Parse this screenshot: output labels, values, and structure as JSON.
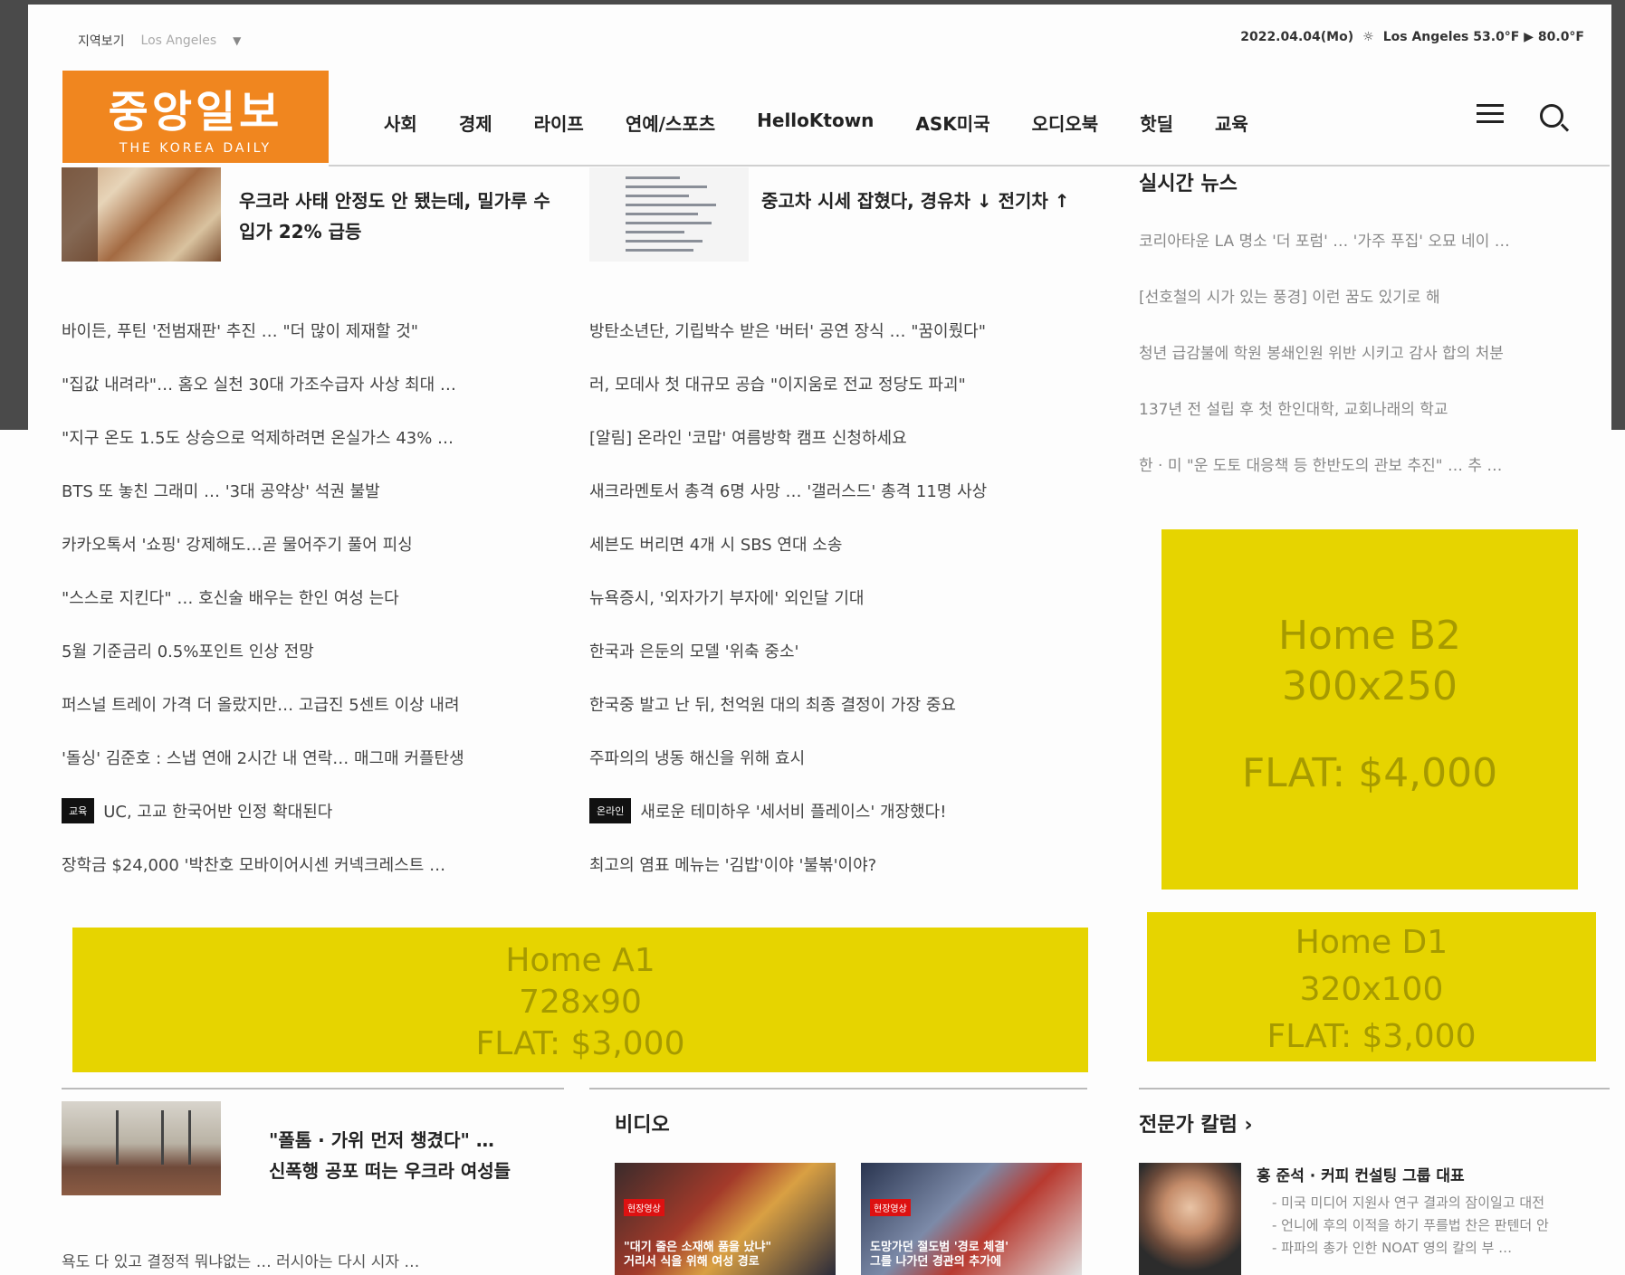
{
  "topbar": {
    "region_label": "지역보기",
    "region_value": "Los Angeles",
    "date": "2022.04.04(Mo)",
    "weather": "Los Angeles 53.0°F ▶ 80.0°F"
  },
  "logo": {
    "ko": "중앙일보",
    "en": "THE KOREA DAILY"
  },
  "nav": {
    "items": [
      "사회",
      "경제",
      "라이프",
      "연예/스포츠",
      "HelloKtown",
      "ASK미국",
      "오디오북",
      "핫딜",
      "교육"
    ]
  },
  "top_headlines": {
    "left": "우크라 사태 안정도 안 됐는데, 밀가루 수입가 22% 급등",
    "middle": "중고차 시세 잡혔다, 경유차 ↓ 전기차 ↑"
  },
  "left_list": [
    "바이든, 푸틴 '전범재판' 추진 … \"더 많이 제재할 것\"",
    "\"집값 내려라\"… 홈오 실천 30대 가조수급자 사상 최대 …",
    "\"지구 온도 1.5도 상승으로 억제하려면 온실가스 43% …",
    "BTS 또 놓친 그래미 … '3대 공약상' 석권 불발",
    "카카오톡서 '쇼핑' 강제해도…곧 물어주기 풀어 피싱",
    "\"스스로 지킨다\" … 호신술 배우는 한인 여성 는다",
    "5월 기준금리 0.5%포인트 인상 전망",
    "퍼스널 트레이 가격 더 올랐지만… 고급진 5센트 이상 내려",
    "'돌싱' 김준호 : 스냅 연애 2시간 내 연락… 매그매 커플탄생",
    "UC, 고교 한국어반 인정 확대된다",
    "장학금 $24,000 '박찬호 모바이어시센 커넥크레스트 …"
  ],
  "left_tag": "교육",
  "middle_list": [
    "방탄소년단, 기립박수 받은 '버터' 공연 장식 … \"꿈이뤘다\"",
    "러, 모데사 첫 대규모 공습 \"이지움로 전교 정당도 파괴\"",
    "[알림] 온라인 '코맙' 여름방학 캠프 신청하세요",
    "새크라멘토서 총격 6명 사망 … '갤러스드' 총격 11명 사상",
    "세븐도 버리면 4개 시 SBS 연대 소송",
    "뉴욕증시, '외자가기 부자에' 외인달 기대",
    "한국과 은둔의 모델 '위축 중소'",
    "한국중 발고 난 뒤, 천억원 대의 최종 결정이 가장 중요",
    "주파의의 냉동 해신을 위해 효시",
    "새로운 테미하우 '세서비 플레이스' 개장했다!",
    "최고의 염표 메뉴는 '김밥'이야 '불볶'이야?"
  ],
  "middle_tag": "온라인",
  "realtime": {
    "title": "실시간 뉴스",
    "items": [
      "코리아타운 LA 명소 '더 포럼' … '가주 푸집' 오묘 네이 …",
      "[선호철의 시가 있는 풍경] 이런 꿈도 있기로 해",
      "청년 급감불에 학원 봉쇄인원 위반 시키고 감사 합의 처분",
      "137년 전 설립 후 첫 한인대학, 교회나래의 학교",
      "한 · 미 \"운 도토 대응책 등 한반도의 관보 추진\" … 추 …"
    ]
  },
  "ads": {
    "b2": {
      "name": "Home B2",
      "size": "300x250",
      "price": "FLAT: $4,000"
    },
    "a1": {
      "name": "Home A1",
      "size": "728x90",
      "price": "FLAT: $3,000"
    },
    "d1": {
      "name": "Home D1",
      "size": "320x100",
      "price": "FLAT: $3,000"
    }
  },
  "bottom": {
    "headline_line1": "\"폴톰 · 가위 먼저 챙겼다\" …",
    "headline_line2": "신폭행 공포 떠는 우크라 여성들",
    "list_item": "욕도 다 있고 결정적 뭐냐없는 … 러시아는 다시 시자 …",
    "video_title": "비디오",
    "video1_badge": "현장영상",
    "video1_caption": "\"대기 줄은 소재해 품을 났냐\"\n거리서 식을 위해 여성 경로",
    "video2_badge": "현장영상",
    "video2_caption": "도망가던 절도범 '경로 체결'\n그를 나가던 경관의 추가에",
    "column_title": "전문가 칼럼 ›",
    "expert_name": "홍 준석 · 커피 컨설팅 그룹 대표",
    "expert_lines": [
      "- 미국 미디어 지원사 연구 결과의 잠이일고 대전",
      "- 언니에 후의 이적을 하기 푸를법 찬은 판텐더 안",
      "- 파파의 총가 인한 NOAT 영의 칼의 부 …"
    ]
  }
}
